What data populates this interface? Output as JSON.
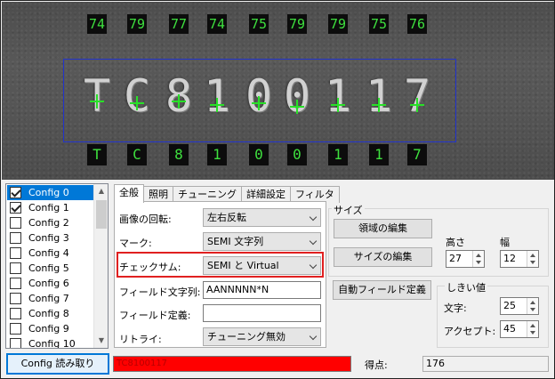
{
  "camera": {
    "char_scores": [
      "74",
      "79",
      "77",
      "74",
      "75",
      "79",
      "79",
      "75",
      "76"
    ],
    "printed_text": [
      "T",
      "C",
      "8",
      "1",
      "0",
      "0",
      "1",
      "1",
      "7"
    ],
    "read_chars": [
      "T",
      "C",
      "8",
      "1",
      "0",
      "0",
      "1",
      "1",
      "7"
    ],
    "roi_color": "#2233cc",
    "overlay_color": "#3ee03e"
  },
  "config_list": {
    "items": [
      {
        "label": "Config 0",
        "checked": true,
        "selected": true
      },
      {
        "label": "Config 1",
        "checked": true,
        "selected": false
      },
      {
        "label": "Config 2",
        "checked": false,
        "selected": false
      },
      {
        "label": "Config 3",
        "checked": false,
        "selected": false
      },
      {
        "label": "Config 4",
        "checked": false,
        "selected": false
      },
      {
        "label": "Config 5",
        "checked": false,
        "selected": false
      },
      {
        "label": "Config 6",
        "checked": false,
        "selected": false
      },
      {
        "label": "Config 7",
        "checked": false,
        "selected": false
      },
      {
        "label": "Config 8",
        "checked": false,
        "selected": false
      },
      {
        "label": "Config 9",
        "checked": false,
        "selected": false
      },
      {
        "label": "Config 10",
        "checked": false,
        "selected": false
      }
    ]
  },
  "tabs": [
    "全般",
    "照明",
    "チューニング",
    "詳細設定",
    "フィルタ"
  ],
  "general": {
    "rotation_label": "画像の回転:",
    "rotation_value": "左右反転",
    "mark_label": "マーク:",
    "mark_value": "SEMI 文字列",
    "checksum_label": "チェックサム:",
    "checksum_value": "SEMI と Virtual",
    "field_string_label": "フィールド文字列:",
    "field_string_value": "AANNNNN*N",
    "field_def_label": "フィールド定義:",
    "field_def_value": "",
    "retry_label": "リトライ:",
    "retry_value": "チューニング無効"
  },
  "size": {
    "group_title": "サイズ",
    "edit_region_button": "領域の編集",
    "edit_size_button": "サイズの編集",
    "auto_field_button": "自動フィールド定義",
    "height_label": "高さ",
    "height_value": "27",
    "width_label": "幅",
    "width_value": "12"
  },
  "threshold": {
    "group_title": "しきい値",
    "char_label": "文字:",
    "char_value": "25",
    "accept_label": "アクセプト:",
    "accept_value": "45"
  },
  "footer": {
    "config_read_button": "Config 読み取り",
    "result_text": "TC8100117",
    "result_color": "#ff0000",
    "score_label": "得点:",
    "score_value": "176"
  }
}
